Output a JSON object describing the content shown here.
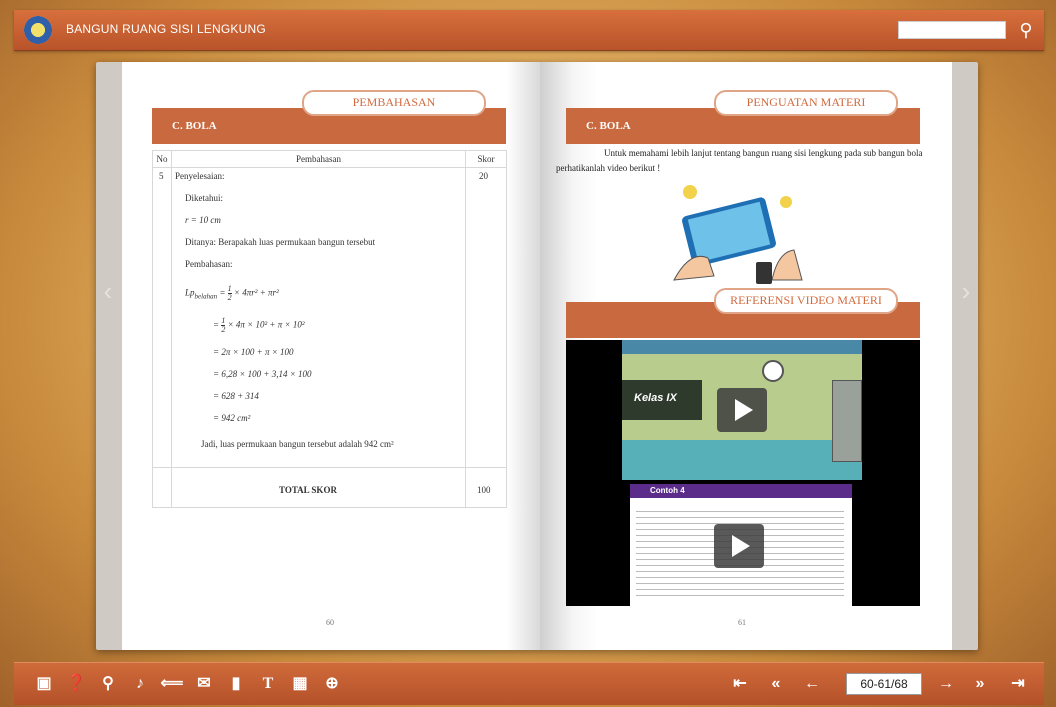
{
  "app": {
    "title": "BANGUN RUANG SISI LENGKUNG"
  },
  "search": {
    "value": "",
    "placeholder": ""
  },
  "left_page": {
    "section_label": "PEMBAHASAN",
    "band_title": "C. BOLA",
    "table": {
      "headers": [
        "No",
        "Pembahasan",
        "Skor"
      ],
      "row_no": "5",
      "row_skor": "20",
      "lines": [
        "Penyelesaian:",
        "Diketahui:",
        "r = 10 cm",
        "Ditanya: Berapakah luas permukaan bangun tersebut",
        "Pembahasan:",
        "Lp",
        "belahan",
        "= ",
        "1",
        "2",
        " × 4πr² + πr²",
        "= ",
        "1",
        "2",
        " × 4π × 10² + π × 10²",
        "= 2π × 100 + π × 100",
        "= 6,28 × 100 + 3,14 × 100",
        "= 628 + 314",
        "= 942 cm²",
        "Jadi, luas permukaan bangun tersebut adalah 942 cm²"
      ],
      "total_label": "TOTAL SKOR",
      "total_value": "100"
    },
    "page_number": "60"
  },
  "right_page": {
    "section_label": "PENGUATAN MATERI",
    "band_title": "C. BOLA",
    "intro_text": "Untuk memahami lebih lanjut tentang bangun ruang sisi lengkung pada sub bangun bola perhatikanlah video berikut !",
    "video_label": "REFERENSI VIDEO MATERI",
    "video1_caption": "Kelas IX",
    "video2_header": "Contoh 4",
    "page_number": "61"
  },
  "toolbar": {
    "page_indicator": "60-61/68"
  },
  "colors": {
    "accent": "#c9693f",
    "label_border": "#e0a487",
    "bar": "#b9532a"
  }
}
